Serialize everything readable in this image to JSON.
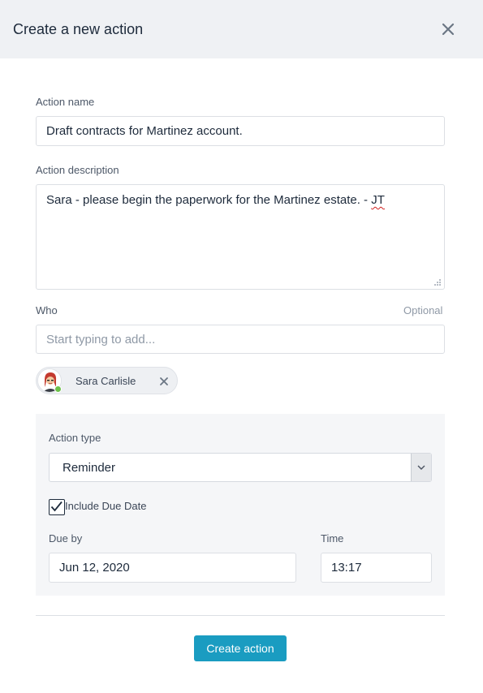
{
  "dialog": {
    "title": "Create a new action",
    "close_icon": "close-icon"
  },
  "form": {
    "action_name": {
      "label": "Action name",
      "value": "Draft contracts for Martinez account."
    },
    "action_description": {
      "label": "Action description",
      "value_main": "Sara - please begin the paperwork for the Martinez estate. - ",
      "value_misspelled": "JT"
    },
    "who": {
      "label": "Who",
      "optional": "Optional",
      "placeholder": "Start typing to add...",
      "selected": [
        {
          "name": "Sara Carlisle",
          "status": "online",
          "avatar_icon": "avatar-icon",
          "remove_icon": "close-icon"
        }
      ]
    },
    "action_type": {
      "label": "Action type",
      "value": "Reminder",
      "dropdown_icon": "chevron-down-icon"
    },
    "include_due_date": {
      "label": "Include Due Date",
      "checked": true
    },
    "due_by": {
      "label": "Due by",
      "value": "Jun 12, 2020"
    },
    "time": {
      "label": "Time",
      "value": "13:17"
    }
  },
  "actions": {
    "submit_label": "Create action"
  },
  "colors": {
    "header_bg": "#eff1f4",
    "accent": "#1a9cc1",
    "online": "#6cc04a",
    "panel_bg": "#f5f6f8"
  }
}
